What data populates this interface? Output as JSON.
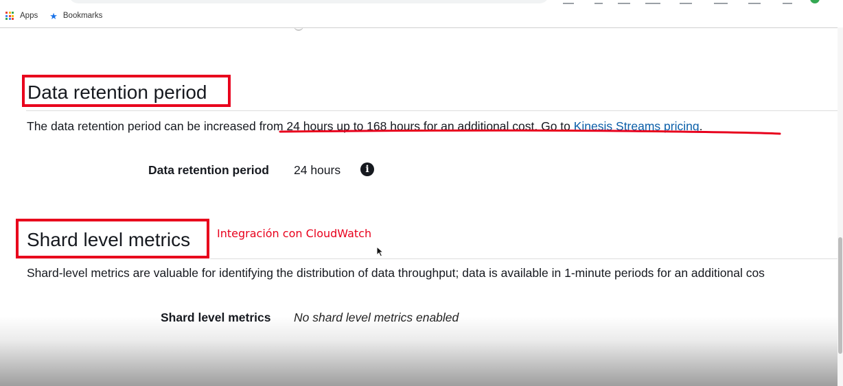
{
  "bookmarks_bar": {
    "apps_label": "Apps",
    "bookmarks_label": "Bookmarks"
  },
  "retention_section": {
    "title": "Data retention period",
    "description_start": "The data retention period can be increased ",
    "description_highlight": "from 24 hours up to 168 hours for an additional cost. Go to ",
    "pricing_link": "Kinesis Streams pricing",
    "description_end": ".",
    "field_label": "Data retention period",
    "field_value": "24 hours",
    "info_icon": "info-icon"
  },
  "shard_section": {
    "title": "Shard level metrics",
    "annotation": "Integración con CloudWatch",
    "description": "Shard-level metrics are valuable for identifying the distribution of data throughput; data is available in 1-minute periods for an additional cos",
    "field_label": "Shard level metrics",
    "field_value": "No shard level metrics enabled"
  },
  "colors": {
    "annotation_red": "#e8001c",
    "link_blue": "#0a5ea8",
    "text": "#16191f",
    "bookmark_star": "#1a73e8"
  }
}
